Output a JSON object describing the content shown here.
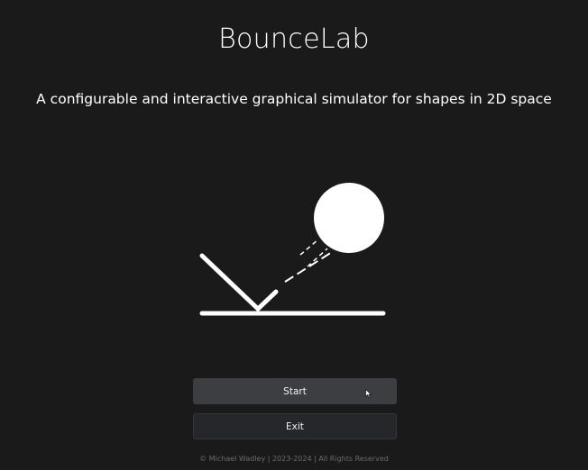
{
  "app": {
    "title": "BounceLab",
    "subtitle": "A configurable and interactive graphical simulator for shapes in 2D space"
  },
  "buttons": {
    "start_label": "Start",
    "exit_label": "Exit"
  },
  "footer": {
    "text": "©  Michael Wadley | 2023-2024 | All Rights Reserved"
  },
  "colors": {
    "background": "#1b1a1b",
    "text": "#ffffff",
    "start_button": "#3c3e42",
    "exit_button": "#26272b"
  },
  "icons": {
    "logo": "bouncing-ball-logo",
    "cursor": "mouse-pointer-icon"
  }
}
